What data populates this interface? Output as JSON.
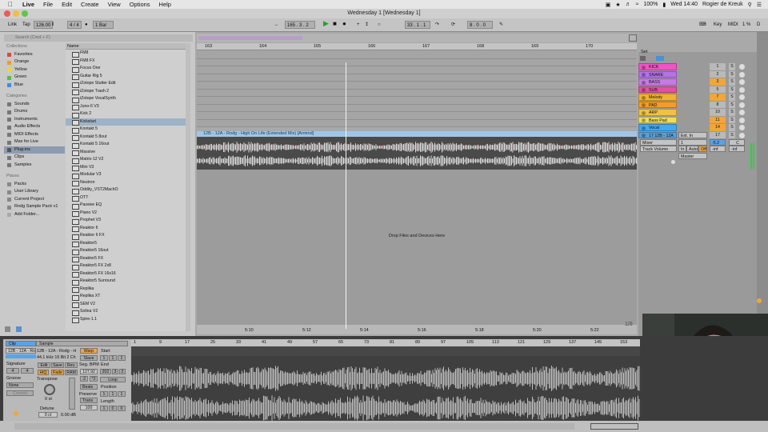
{
  "menubar": {
    "app": "Live",
    "items": [
      "File",
      "Edit",
      "Create",
      "View",
      "Options",
      "Help"
    ],
    "battery": "100%",
    "clock": "Wed 14:40",
    "user": "Rogier de Kreuk"
  },
  "window_title": "Wednesday 1  [Wednesday 1]",
  "transport": {
    "link": "Link",
    "tap": "Tap",
    "tempo": "126.00",
    "signature": "4 / 4",
    "quantize": "1 Bar",
    "position": "165 . 3 . 2",
    "loop_start": "33 . 1 . 1",
    "loop_length": "8 . 0 . 0",
    "key_label": "Key",
    "midi_label": "MIDI",
    "cpu": "1 %",
    "d_label": "D"
  },
  "browser": {
    "search_placeholder": "Search (Cmd + F)",
    "collections_title": "Collections",
    "collections": [
      {
        "label": "Favorites",
        "color": "#e0463c"
      },
      {
        "label": "Orange",
        "color": "#f29a2b"
      },
      {
        "label": "Yellow",
        "color": "#f1d33b"
      },
      {
        "label": "Green",
        "color": "#4fc04a"
      },
      {
        "label": "Blue",
        "color": "#3f8ce8"
      }
    ],
    "categories_title": "Categories",
    "categories": [
      "Sounds",
      "Drums",
      "Instruments",
      "Audio Effects",
      "MIDI Effects",
      "Max for Live",
      "Plug-ins",
      "Clips",
      "Samples"
    ],
    "categories_selected": 6,
    "places_title": "Places",
    "places": [
      "Packs",
      "User Library",
      "Current Project",
      "Rodg Sample Pack v1",
      "Add Folder..."
    ],
    "list_header": "Name",
    "list_items": [
      "FM8",
      "FM8 FX",
      "Focus One",
      "Guitar Rig 5",
      "iZotope Stutter Edit",
      "iZotope Trash 2",
      "iZotope VocalSynth",
      "Juno-6 V3",
      "Kick 2",
      "Kickstart",
      "Kontakt 5",
      "Kontakt 5 8out",
      "Kontakt 5 16out",
      "Massive",
      "Matrix-12 V2",
      "Mini V3",
      "Modular V3",
      "Neutron",
      "Oddity_VST2MachO",
      "OTT",
      "Passive EQ",
      "Piano V2",
      "Prophet V3",
      "Reaktor 6",
      "Reaktor 6 FX",
      "Reaktor5",
      "Reaktor5 16out",
      "Reaktor5 FX",
      "Reaktor5 FX 2x8",
      "Reaktor5 FX 16x16",
      "Reaktor5 Surround",
      "Replika",
      "Replika XT",
      "SEM V2",
      "Solina V2",
      "Spire-1.1"
    ],
    "list_selected": 9
  },
  "arrangement": {
    "ruler": [
      "163",
      "164",
      "165",
      "166",
      "167",
      "168",
      "169",
      "170"
    ],
    "clip_name": "12B - 12A - Rodg - High On Life (Extended Mix) [Armind]",
    "drop_text": "Drop Files and Devices Here",
    "time_ruler": [
      "5:10",
      "5:12",
      "5:14",
      "5:16",
      "5:18",
      "5:20",
      "5:22"
    ],
    "zoom_label": "1/8"
  },
  "mixer": {
    "set_label": "Set",
    "tracks": [
      {
        "name": "KICK",
        "color": "#ee55c4",
        "num": "1"
      },
      {
        "name": "SNARE",
        "color": "#b572e8",
        "num": "2"
      },
      {
        "name": "BASS",
        "color": "#c67ae6",
        "num": "3"
      },
      {
        "name": "SUB",
        "color": "#e74fa0",
        "num": "5"
      },
      {
        "name": "Melody",
        "color": "#f3b12c",
        "num": "7"
      },
      {
        "name": "PAD",
        "color": "#f29d2b",
        "num": "8"
      },
      {
        "name": "ARP",
        "color": "#f3bf44",
        "num": "10"
      },
      {
        "name": "Bass Pad",
        "color": "#eede5b",
        "num": "11"
      },
      {
        "name": "Vocal",
        "color": "#3fa9ee",
        "num": "14"
      },
      {
        "name": "17 12B - 12A",
        "color": "#5a9fd8",
        "num": "17"
      }
    ],
    "solo_label": "S",
    "input_type": "Ext. In",
    "input_channel": "1",
    "mixer_label": "Mixer",
    "volume_label": "Track Volume",
    "volume_value": "-5.2",
    "pan_value": "C",
    "monitor_in": "In",
    "monitor_auto": "Auto",
    "monitor_off": "Off",
    "send1": "-inf",
    "send2": "-inf",
    "output": "Master"
  },
  "clip_view": {
    "tab_clip": "Clip",
    "tab_sample": "Sample",
    "clip_name": "12B - 12A - Rodg - High On",
    "signature_label": "Signature",
    "sig_num": "4",
    "sig_den": "4",
    "groove_label": "Groove",
    "groove_value": "None",
    "commit_label": "Commit",
    "sample_name": "12B - 12A - Rodg - H",
    "sample_info": "44.1 kHz 16 Bit 2 Ch",
    "edit": "Edit",
    "save": "Save",
    "rev": "Rev.",
    "hiq": "HiQ",
    "fade": "Fade",
    "ram": "RAM",
    "transpose_label": "Transpose",
    "transpose_value": "0 st",
    "detune_label": "Detune",
    "detune_value": "0 ct",
    "gain_value": "0.00 dB",
    "warp": "Warp",
    "slave": "Slave",
    "seg_bpm_label": "Seg. BPM",
    "seg_bpm": "127.92",
    "half": ":2",
    "double": "*2",
    "mode": "Beats",
    "preserve_label": "Preserve",
    "trans_label": "Trans",
    "loop_amount": "100",
    "start_label": "Start",
    "start": [
      "1",
      "1",
      "1"
    ],
    "end_label": "End",
    "end": [
      "202",
      "3",
      "2"
    ],
    "loop_label": "Loop",
    "position_label": "Position",
    "position": [
      "1",
      "1",
      "1"
    ],
    "length_label": "Length",
    "length": [
      "1",
      "0",
      "0"
    ],
    "ruler": [
      "1",
      "9",
      "17",
      "25",
      "33",
      "41",
      "49",
      "57",
      "65",
      "73",
      "81",
      "89",
      "97",
      "105",
      "113",
      "121",
      "129",
      "137",
      "145",
      "153"
    ]
  }
}
